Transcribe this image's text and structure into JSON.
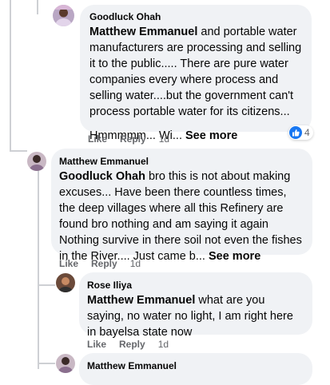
{
  "comments": [
    {
      "author": "Goodluck Ohah",
      "mention": "Matthew Emmanuel",
      "text_main": " and portable water manufacturers are processing and selling it to the public..... There are pure water companies every where process and selling water....but the government can't process portable water for its citizens...",
      "text_tail": "Hmmmmm... Wi... ",
      "see_more": "See more",
      "actions": {
        "like": "Like",
        "reply": "Reply",
        "time": "1d"
      },
      "reaction_count": "4",
      "avatar_icon": "avatar-icon"
    },
    {
      "author": "Matthew Emmanuel",
      "mention": "Goodluck Ohah",
      "text_main": " bro this is not about making excuses... Have been there countless times, the deep villages where all this Refinery are found bro nothing and am saying it again Nothing survive in there soil not even the fishes in the River.... Just came b... ",
      "see_more": "See more",
      "actions": {
        "like": "Like",
        "reply": "Reply",
        "time": "1d"
      }
    },
    {
      "author": "Rose Iliya",
      "mention": "Matthew Emmanuel",
      "text_main": " what are you saying, no water no light, I am right here in bayelsa state now",
      "actions": {
        "like": "Like",
        "reply": "Reply",
        "time": "1d"
      }
    },
    {
      "author": "Matthew Emmanuel"
    }
  ],
  "colors": {
    "bubble": "#f0f2f5",
    "meta": "#65676b",
    "like_blue": "#1877f2",
    "thread_line": "#ced0d4"
  }
}
